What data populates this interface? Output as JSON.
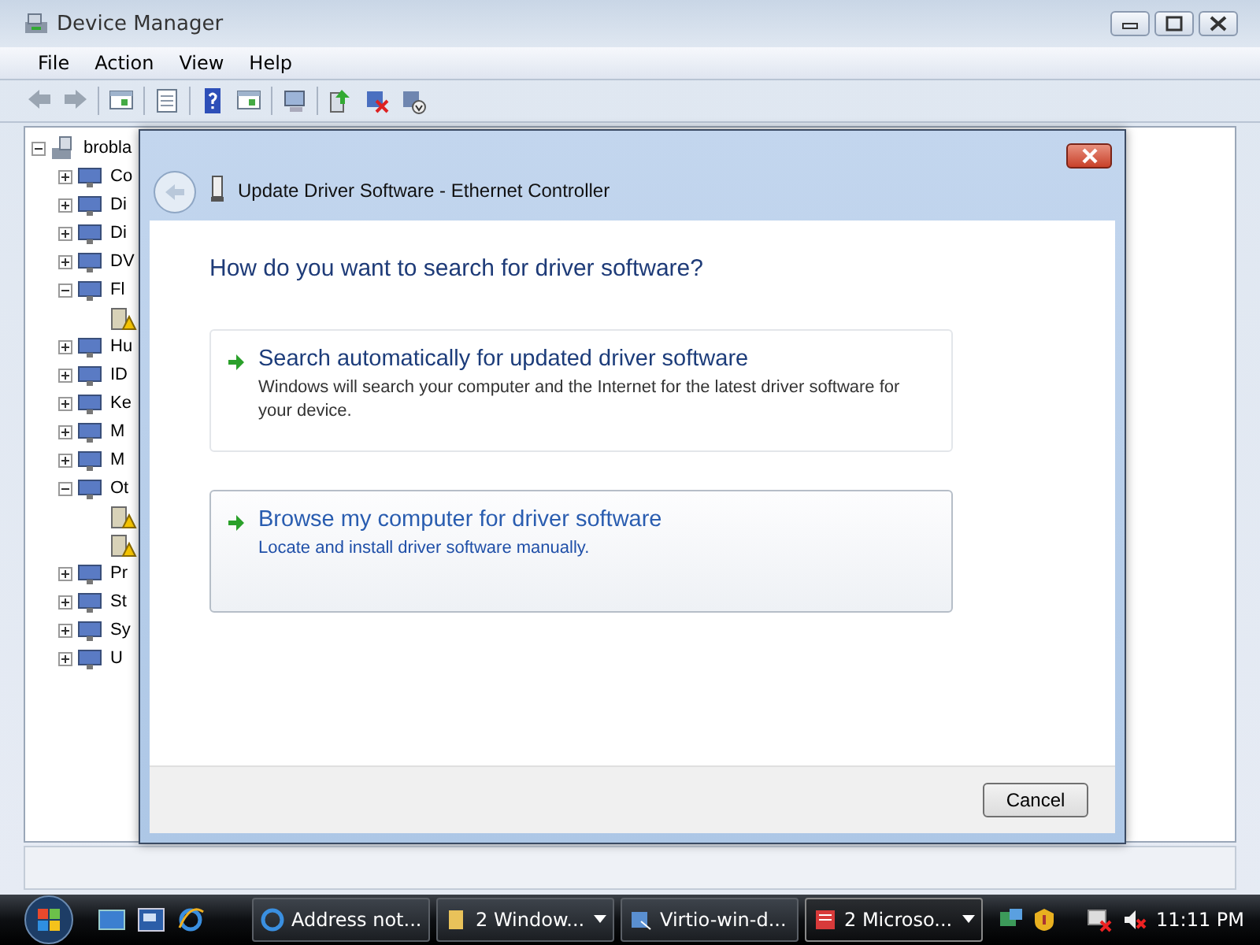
{
  "window": {
    "title": "Device Manager"
  },
  "menu": [
    "File",
    "Action",
    "View",
    "Help"
  ],
  "tree": {
    "label": "brobla",
    "expanded": true,
    "children": [
      {
        "label": "Co",
        "expanded": false
      },
      {
        "label": "Di",
        "expanded": false
      },
      {
        "label": "Di",
        "expanded": false
      },
      {
        "label": "DV",
        "expanded": false
      },
      {
        "label": "Fl",
        "expanded": true,
        "children": [
          {
            "warning": true
          }
        ]
      },
      {
        "label": "Hu",
        "expanded": false
      },
      {
        "label": "ID",
        "expanded": false
      },
      {
        "label": "Ke",
        "expanded": false
      },
      {
        "label": "M",
        "expanded": false
      },
      {
        "label": "M",
        "expanded": false
      },
      {
        "label": "Ot",
        "expanded": true,
        "children": [
          {
            "warning": true
          },
          {
            "warning": true
          }
        ]
      },
      {
        "label": "Pr",
        "expanded": false
      },
      {
        "label": "St",
        "expanded": false
      },
      {
        "label": "Sy",
        "expanded": false
      },
      {
        "label": "U",
        "expanded": false
      }
    ]
  },
  "dialog": {
    "title": "Update Driver Software - Ethernet Controller",
    "heading": "How do you want to search for driver software?",
    "options": [
      {
        "title": "Search automatically for updated driver software",
        "description": "Windows will search your computer and the Internet for the latest driver software for your device.",
        "selected": false
      },
      {
        "title": "Browse my computer for driver software",
        "description": "Locate and install driver software manually.",
        "selected": true
      }
    ],
    "buttons": [
      "Cancel"
    ]
  },
  "taskbar": {
    "tasks": [
      {
        "label": "Address not...",
        "grouped": false,
        "selected": false
      },
      {
        "label": "2 Window...",
        "grouped": true,
        "selected": false
      },
      {
        "label": "Virtio-win-d...",
        "grouped": false,
        "selected": false
      },
      {
        "label": "2 Microso...",
        "grouped": true,
        "selected": true
      }
    ],
    "clock": "11:11 PM"
  }
}
